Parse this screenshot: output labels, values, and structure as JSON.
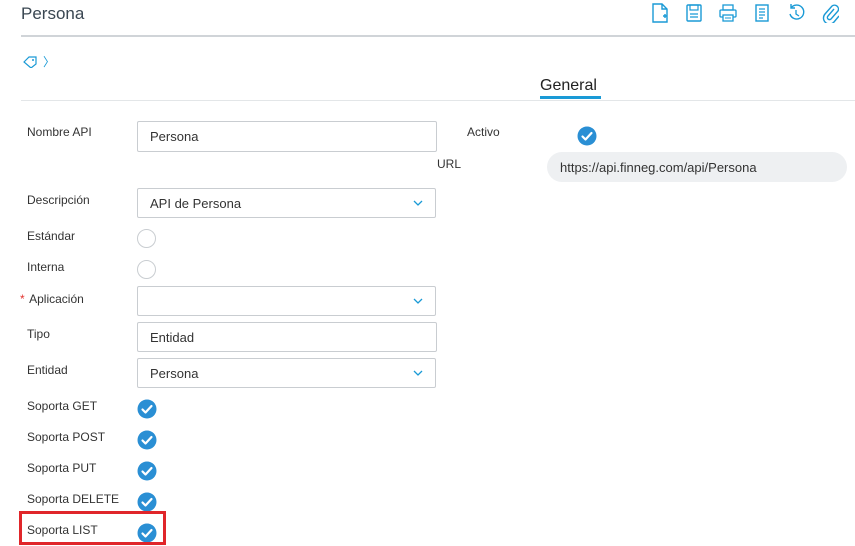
{
  "header": {
    "title": "Persona"
  },
  "toolbar": {
    "icons": [
      "new-document-icon",
      "save-icon",
      "print-icon",
      "document-icon",
      "history-icon",
      "attach-icon"
    ]
  },
  "breadcrumb": {
    "icon": "tag-icon",
    "separator": "〉"
  },
  "tabs": [
    {
      "label": "General",
      "active": true
    }
  ],
  "form": {
    "nombre_api": {
      "label": "Nombre API",
      "value": "Persona"
    },
    "activo": {
      "label": "Activo",
      "checked": true
    },
    "url": {
      "label": "URL",
      "value": "https://api.finneg.com/api/Persona"
    },
    "descripcion": {
      "label": "Descripción",
      "value": "API de Persona"
    },
    "estandar": {
      "label": "Estándar",
      "checked": false
    },
    "interna": {
      "label": "Interna",
      "checked": false
    },
    "aplicacion": {
      "label": "Aplicación",
      "required_mark": "*",
      "value": ""
    },
    "tipo": {
      "label": "Tipo",
      "value": "Entidad"
    },
    "entidad": {
      "label": "Entidad",
      "value": "Persona"
    },
    "soporta_get": {
      "label": "Soporta GET",
      "checked": true
    },
    "soporta_post": {
      "label": "Soporta POST",
      "checked": true
    },
    "soporta_put": {
      "label": "Soporta PUT",
      "checked": true
    },
    "soporta_delete": {
      "label": "Soporta DELETE",
      "checked": true
    },
    "soporta_list": {
      "label": "Soporta LIST",
      "checked": true
    }
  },
  "colors": {
    "accent": "#1a9ad6",
    "check": "#2a8fd4",
    "highlight": "#e0262a"
  }
}
